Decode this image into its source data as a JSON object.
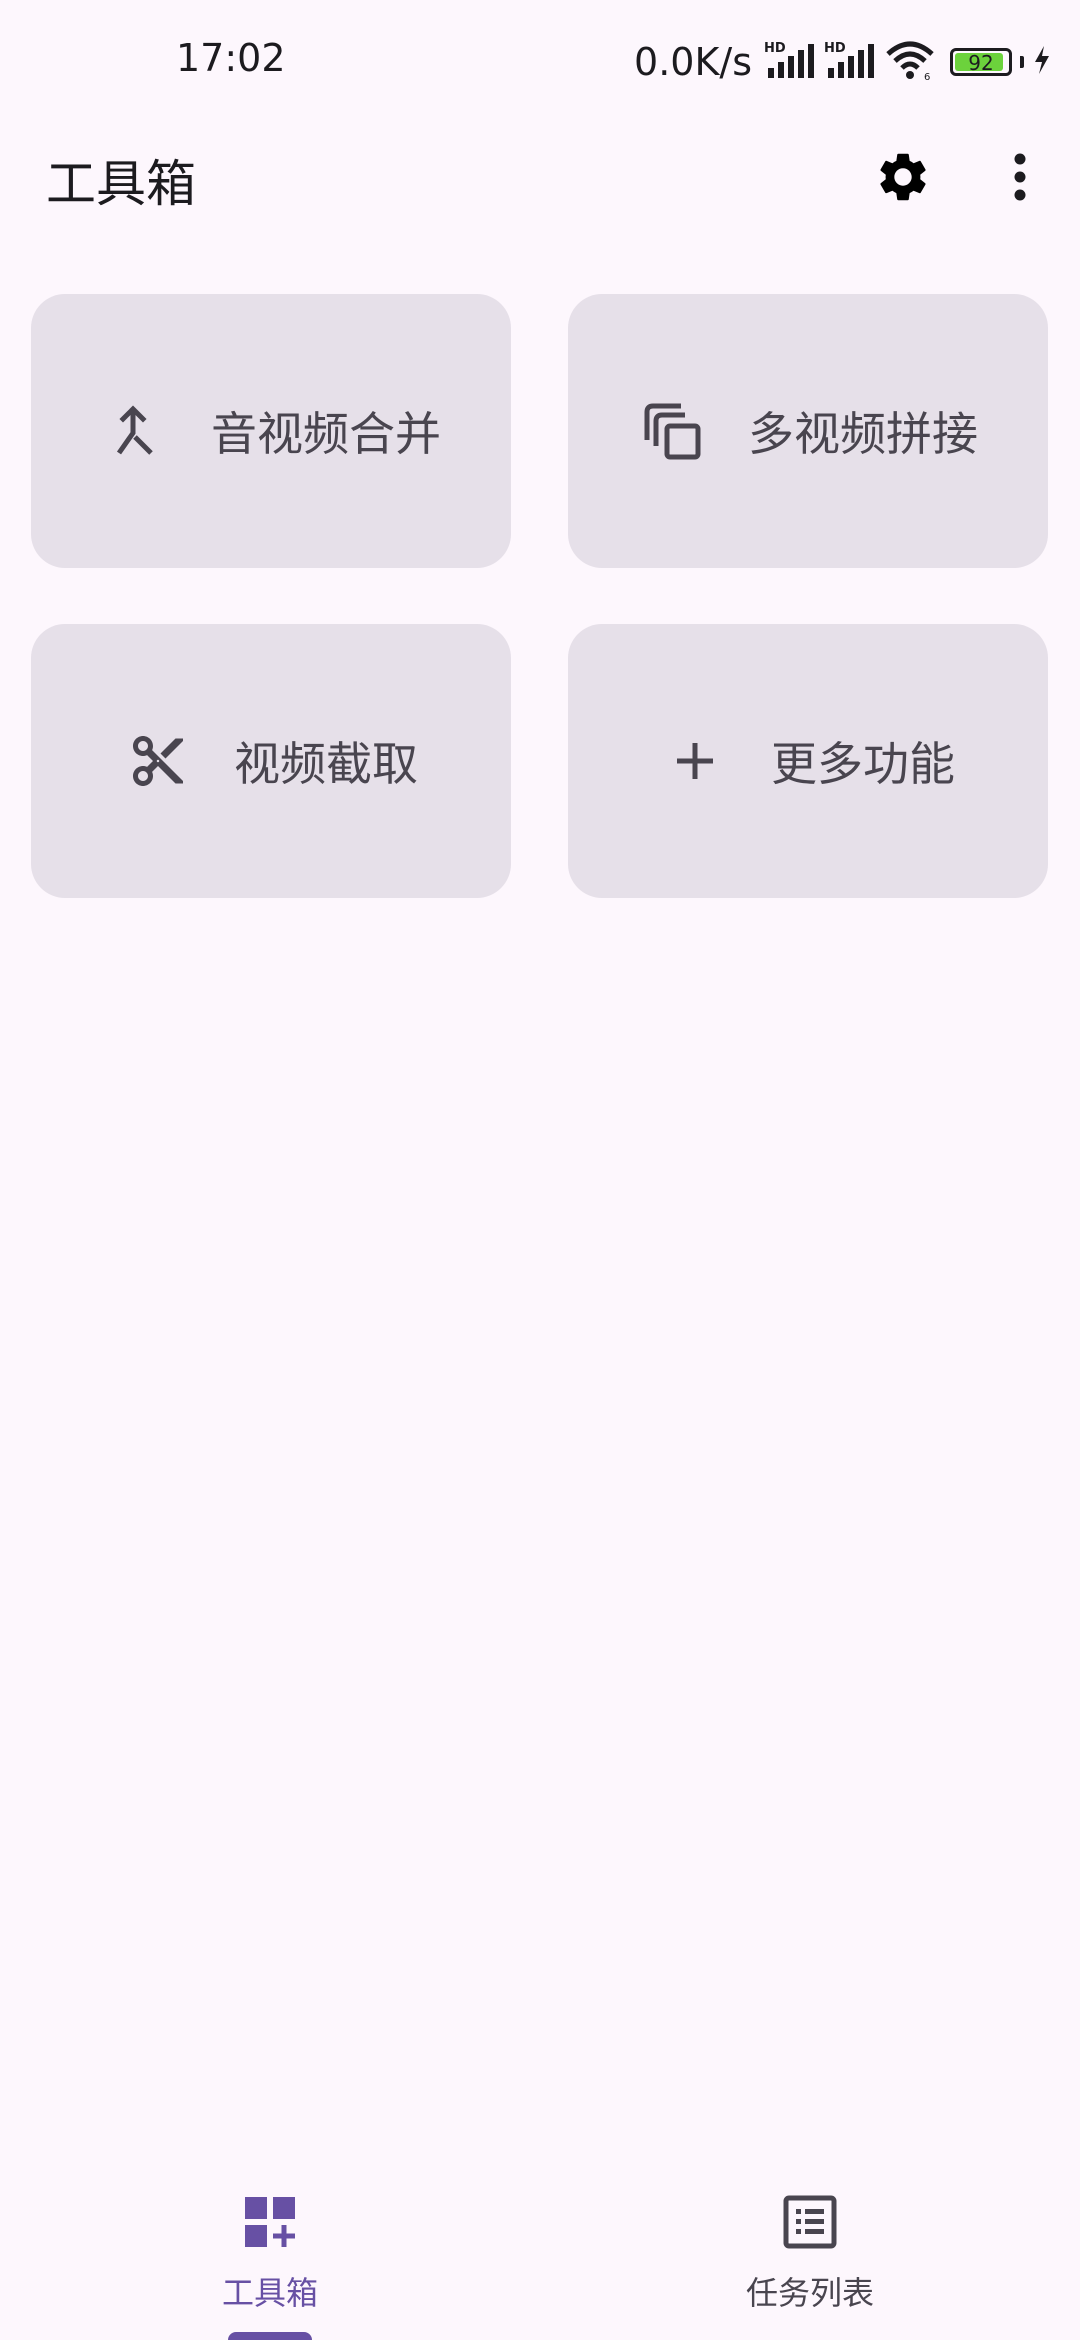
{
  "status_bar": {
    "time": "17:02",
    "net_speed": "0.0K/s",
    "battery_level": "92",
    "battery_fraction": 0.92
  },
  "app_bar": {
    "title": "工具箱",
    "settings_icon": "gear-icon",
    "more_icon": "more-vert-icon"
  },
  "tools": [
    {
      "label": "音视频合并",
      "icon": "merge-icon"
    },
    {
      "label": "多视频拼接",
      "icon": "copy-stack-icon"
    },
    {
      "label": "视频截取",
      "icon": "scissors-icon"
    },
    {
      "label": "更多功能",
      "icon": "plus-icon"
    }
  ],
  "bottom_nav": {
    "items": [
      {
        "label": "工具箱",
        "icon": "dashboard-add-icon",
        "selected": true
      },
      {
        "label": "任务列表",
        "icon": "list-icon",
        "selected": false
      }
    ]
  },
  "colors": {
    "background": "#fdf7fd",
    "card": "#e6e0e9",
    "accent": "#6750a4",
    "text": "#1c1b1f",
    "text_secondary": "#49454f",
    "battery": "#6cd23c"
  }
}
